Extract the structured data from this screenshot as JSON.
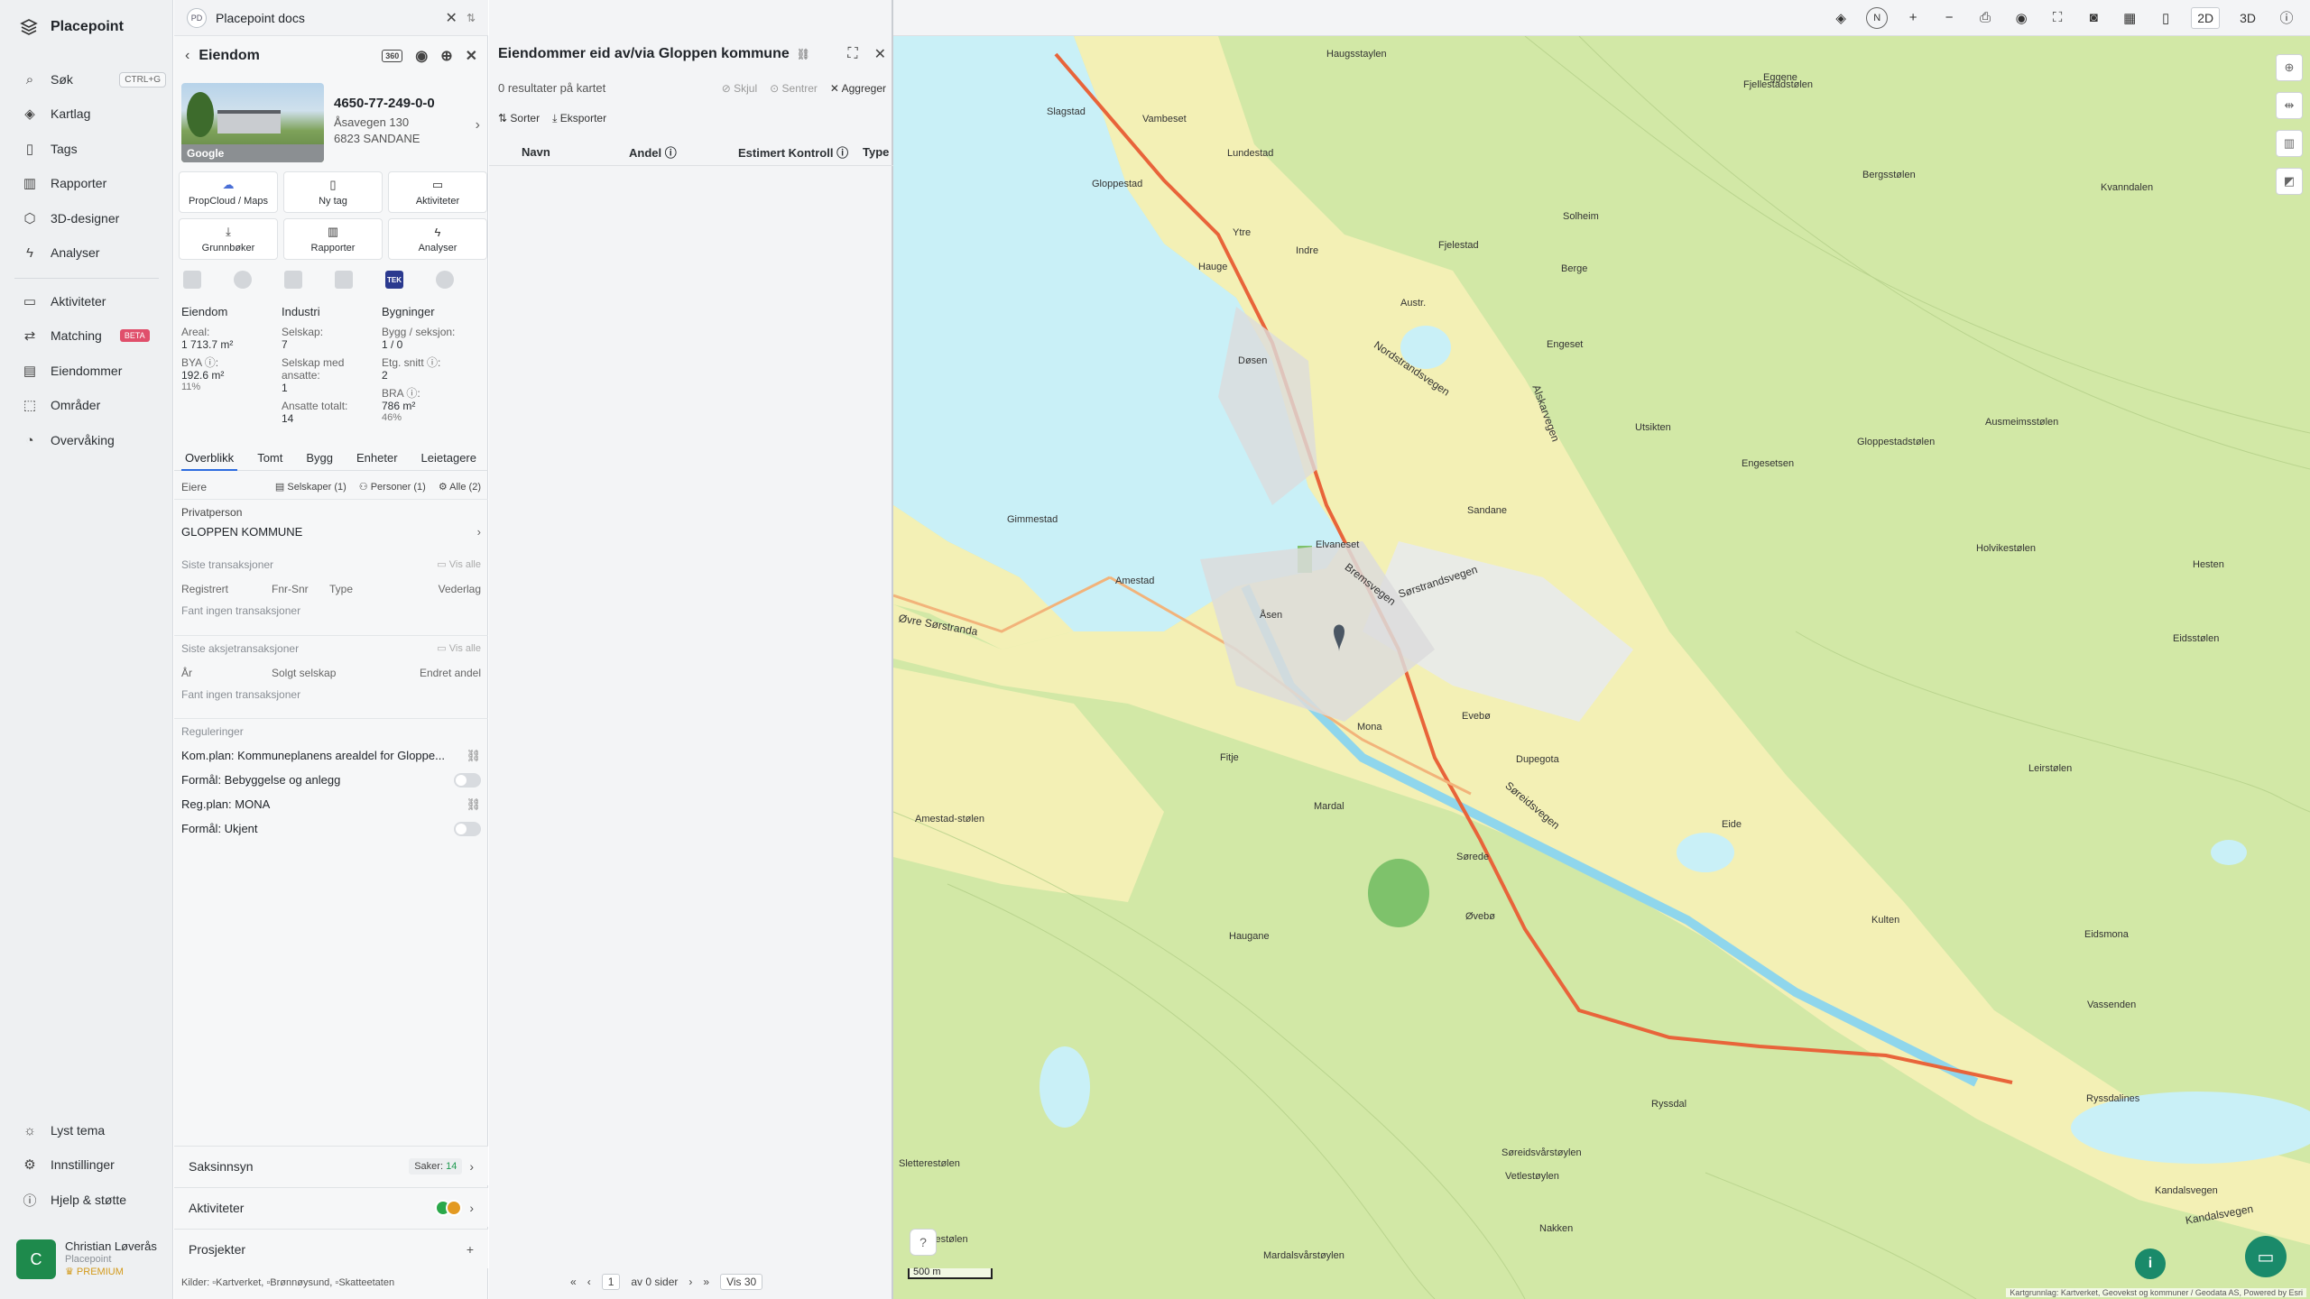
{
  "app": {
    "name": "Placepoint"
  },
  "nav": {
    "items": [
      {
        "label": "Søk",
        "shortcut": "CTRL+G",
        "icon": "search-icon"
      },
      {
        "label": "Kartlag",
        "icon": "layers-icon"
      },
      {
        "label": "Tags",
        "icon": "bookmark-icon"
      },
      {
        "label": "Rapporter",
        "icon": "chart-icon"
      },
      {
        "label": "3D-designer",
        "icon": "cube-icon"
      },
      {
        "label": "Analyser",
        "icon": "bolt-icon"
      },
      {
        "label": "Aktiviteter",
        "icon": "chat-icon"
      },
      {
        "label": "Matching",
        "badge": "BETA",
        "icon": "matching-icon"
      },
      {
        "label": "Eiendommer",
        "icon": "building-icon"
      },
      {
        "label": "Områder",
        "icon": "area-icon"
      },
      {
        "label": "Overvåking",
        "icon": "monitor-icon"
      }
    ],
    "bottom": [
      {
        "label": "Lyst tema",
        "icon": "sun-icon"
      },
      {
        "label": "Innstillinger",
        "icon": "gear-icon"
      },
      {
        "label": "Hjelp & støtte",
        "icon": "help-icon"
      }
    ],
    "user": {
      "initial": "C",
      "name": "Christian Løverås",
      "org": "Placepoint",
      "plan": "PREMIUM"
    }
  },
  "docs_tab": {
    "badge": "PD",
    "label": "Placepoint docs"
  },
  "property": {
    "title": "Eiendom",
    "badge_360": "360",
    "photo_logo": "Google",
    "id": "4650-77-249-0-0",
    "address_line1": "Åsavegen 130",
    "address_line2": "6823 SANDANE",
    "tiles": [
      {
        "label": "PropCloud / Maps",
        "icon": "propcloud-icon"
      },
      {
        "label": "Ny tag",
        "icon": "bookmark-icon"
      },
      {
        "label": "Aktiviteter",
        "icon": "chat-icon"
      },
      {
        "label": "Grunnbøker",
        "icon": "download-icon"
      },
      {
        "label": "Rapporter",
        "icon": "chart-icon"
      },
      {
        "label": "Analyser",
        "icon": "bolt-icon"
      }
    ],
    "mini_tek": "TEK",
    "stats": {
      "col1": {
        "head": "Eiendom",
        "areal_label": "Areal:",
        "areal_value": "1 713.7 m²",
        "bya_label": "BYA ⓘ:",
        "bya_value": "192.6 m²",
        "bya_pct": "11%"
      },
      "col2": {
        "head": "Industri",
        "selskap_label": "Selskap:",
        "selskap_value": "7",
        "selskap_ansatte_label": "Selskap med ansatte:",
        "selskap_ansatte_value": "1",
        "ansatte_label": "Ansatte totalt:",
        "ansatte_value": "14"
      },
      "col3": {
        "head": "Bygninger",
        "bygg_label": "Bygg / seksjon:",
        "bygg_value": "1 / 0",
        "etg_label": "Etg. snitt ⓘ:",
        "etg_value": "2",
        "bra_label": "BRA ⓘ:",
        "bra_value": "786 m²",
        "bra_pct": "46%"
      }
    },
    "tabs": [
      "Overblikk",
      "Tomt",
      "Bygg",
      "Enheter",
      "Leietagere"
    ],
    "owners": {
      "label": "Eiere",
      "chip1": "Selskaper (1)",
      "chip2": "Personer (1)",
      "chip3": "Alle (2)",
      "type": "Privatperson",
      "name": "GLOPPEN KOMMUNE"
    },
    "transactions": {
      "title": "Siste transaksjoner",
      "link": "Vis alle",
      "cols": [
        "Registrert",
        "Fnr-Snr",
        "Type",
        "Vederlag"
      ],
      "empty": "Fant ingen transaksjoner"
    },
    "share_tx": {
      "title": "Siste aksjetransaksjoner",
      "link": "Vis alle",
      "cols": [
        "År",
        "Solgt selskap",
        "Endret andel"
      ],
      "empty": "Fant ingen transaksjoner"
    },
    "regulations": {
      "title": "Reguleringer",
      "items": [
        "Kom.plan: Kommuneplanens arealdel for Gloppe...",
        "Formål: Bebyggelse og anlegg",
        "Reg.plan: MONA",
        "Formål: Ukjent"
      ]
    },
    "bottom": {
      "saksinnsyn": "Saksinnsyn",
      "saker_label": "Saker:",
      "saker_value": "14",
      "aktiviteter": "Aktiviteter",
      "prosjekter": "Prosjekter"
    },
    "kilder": "Kilder: ▫Kartverket, ▫Brønnøysund, ▫Skatteetaten"
  },
  "results": {
    "title": "Eiendommer eid av/via Gloppen kommune",
    "count": "0 resultater på kartet",
    "actions": [
      "Skjul",
      "Sentrer",
      "Aggreger"
    ],
    "sort": "Sorter",
    "export": "Eksporter",
    "columns": [
      "Navn",
      "Andel ⓘ",
      "Estimert Kontroll ⓘ",
      "Type"
    ],
    "pager": {
      "page": "1",
      "of": "av 0 sider",
      "per": "Vis 30"
    }
  },
  "map": {
    "mode_2d": "2D",
    "mode_3d": "3D",
    "scale": "500 m",
    "attribution": "Kartgrunnlag: Kartverket, Geovekst og kommuner / Geodata AS, Powered by Esri",
    "colors": {
      "water": "#c9f0f7",
      "land": "#f3f0b5",
      "forest": "#cfe6a4",
      "road": "#e8643a"
    },
    "place_labels": [
      "Haugsstaylen",
      "Eggene",
      "Slagstad",
      "Vambeset",
      "Lundestad",
      "Fjellestadstølen",
      "Gloppestad",
      "Bergsstølen",
      "Kvanndalen",
      "Solheim",
      "Ytre",
      "Indre",
      "Fjelestad",
      "Hauge",
      "Berge",
      "Austr.",
      "Døsen",
      "Engeset",
      "Utsikten",
      "Ausmeimsstølen",
      "Gloppestadstølen",
      "Engesetsen",
      "Sandane",
      "Gimmestad",
      "Amestad",
      "Elvaneset",
      "Holvikestølen",
      "Hesten",
      "Åsen",
      "Mona",
      "Eidsstølen",
      "Evebø",
      "Dupegota",
      "Leirstølen",
      "Fitje",
      "Mardal",
      "Eide",
      "Sørede",
      "Kulten",
      "Haugane",
      "Øvebø",
      "Eidsmona",
      "Vassenden",
      "Ryssdal",
      "Ryssdalines",
      "Kandalsvegen",
      "Amestad-stølen",
      "Søreidsvårstøylen",
      "Vetlestøylen",
      "Nakken",
      "Mardalsvårstøylen",
      "Sletterestølen",
      "Amestølen"
    ],
    "road_labels": [
      "Nordstrandsvegen",
      "Sørstrandsvegen",
      "Bremsvegen",
      "Søreidsvegen",
      "Alskarvegen",
      "Øvre Sørstranda",
      "Kandalsvegen"
    ]
  }
}
